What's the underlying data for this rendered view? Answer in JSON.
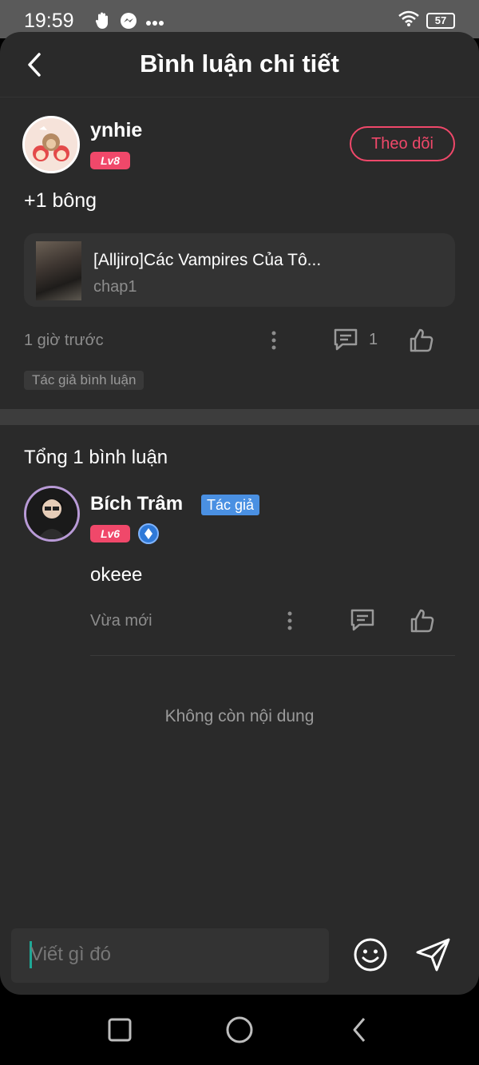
{
  "status_bar": {
    "time": "19:59",
    "battery": "57",
    "icons": [
      "hand-icon",
      "messenger-icon",
      "more-dots-icon",
      "wifi-icon",
      "battery-icon"
    ]
  },
  "header": {
    "title": "Bình luận chi tiết",
    "back_icon": "back-arrow-icon"
  },
  "main_comment": {
    "username": "ynhie",
    "level": "Lv8",
    "follow_label": "Theo dõi",
    "text": "+1 bông",
    "story": {
      "title": "[Alljiro]Các Vampires Của Tô...",
      "chapter": "chap1"
    },
    "time": "1 giờ trước",
    "reply_count": "1",
    "author_tag": "Tác giả bình luận"
  },
  "replies": {
    "total_label": "Tổng 1 bình luận",
    "items": [
      {
        "username": "Bích Trâm",
        "role": "Tác giả",
        "level": "Lv6",
        "text": "okeee",
        "time": "Vừa mới"
      }
    ],
    "end_label": "Không còn nội dung"
  },
  "composer": {
    "placeholder": "Viết gì đó"
  },
  "colors": {
    "accent_pink": "#f0486a",
    "author_blue": "#4a90e2",
    "background": "#2a2a2a",
    "caret_teal": "#1ea896"
  }
}
